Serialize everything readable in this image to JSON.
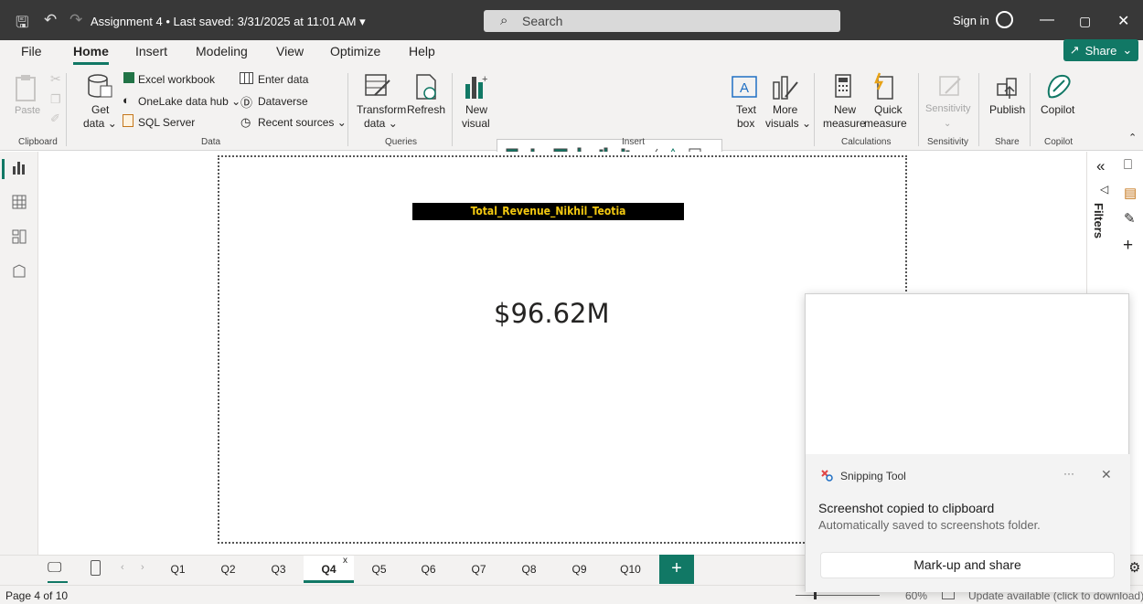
{
  "titlebar": {
    "doc_title": "Assignment 4 • Last saved: 3/31/2025 at 11:01 AM ▾",
    "search_placeholder": "Search",
    "sign_in": "Sign in"
  },
  "menu": {
    "tabs": [
      "File",
      "Home",
      "Insert",
      "Modeling",
      "View",
      "Optimize",
      "Help"
    ],
    "active": "Home",
    "share_label": "Share"
  },
  "ribbon": {
    "clipboard": {
      "paste": "Paste",
      "group": "Clipboard"
    },
    "data": {
      "get_data": "Get",
      "get_data2": "data ⌄",
      "excel": "Excel workbook",
      "onelake": "OneLake data hub ⌄",
      "sql": "SQL Server",
      "enter_data": "Enter data",
      "dataverse": "Dataverse",
      "recent": "Recent sources ⌄",
      "group": "Data"
    },
    "queries": {
      "transform": "Transform",
      "transform2": "data ⌄",
      "refresh": "Refresh",
      "group": "Queries"
    },
    "insert": {
      "new_visual": "New",
      "new_visual2": "visual",
      "text_box": "Text",
      "text_box2": "box",
      "more_visuals": "More",
      "more_visuals2": "visuals ⌄",
      "group": "Insert"
    },
    "calculations": {
      "new_measure": "New",
      "new_measure2": "measure",
      "quick_measure": "Quick",
      "quick_measure2": "measure",
      "group": "Calculations"
    },
    "sensitivity": {
      "label": "Sensitivity",
      "group": "Sensitivity"
    },
    "share": {
      "publish": "Publish",
      "group": "Share"
    },
    "copilot": {
      "label": "Copilot",
      "group": "Copilot"
    }
  },
  "report": {
    "card_title": "Total_Revenue_Nikhil_Teotia",
    "card_value": "$96.62M"
  },
  "right_panel": {
    "filters": "Filters"
  },
  "pages": {
    "tabs": [
      "Q1",
      "Q2",
      "Q3",
      "Q4",
      "Q5",
      "Q6",
      "Q7",
      "Q8",
      "Q9",
      "Q10"
    ],
    "active": "Q4",
    "close_mark": "x",
    "add": "+"
  },
  "status": {
    "page": "Page 4 of 10",
    "zoom": "60%",
    "update": "Update available (click to download)"
  },
  "toast": {
    "app": "Snipping Tool",
    "more": "···",
    "close": "✕",
    "headline": "Screenshot copied to clipboard",
    "sub": "Automatically saved to screenshots folder.",
    "action": "Mark-up and share"
  },
  "colors": {
    "accent": "#117865",
    "titlebar": "#383838",
    "card_title_text": "#f2c811"
  }
}
